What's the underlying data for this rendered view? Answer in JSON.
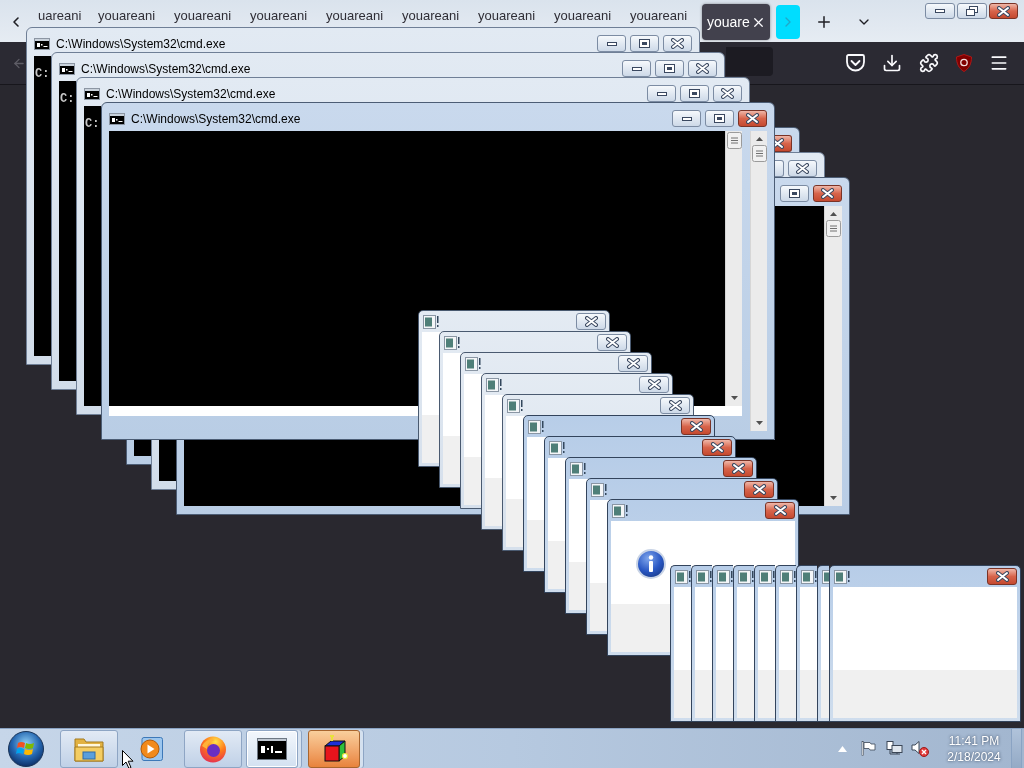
{
  "browser": {
    "tabs": [
      {
        "label": "uareani",
        "selected": false
      },
      {
        "label": "youareani",
        "selected": false
      },
      {
        "label": "youareani",
        "selected": false
      },
      {
        "label": "youareani",
        "selected": false
      },
      {
        "label": "youareani",
        "selected": false
      },
      {
        "label": "youareani",
        "selected": false
      },
      {
        "label": "youareani",
        "selected": false
      },
      {
        "label": "youareani",
        "selected": false
      },
      {
        "label": "youareani",
        "selected": false
      },
      {
        "label": "youare",
        "selected": true
      }
    ]
  },
  "cmd_windows_back": [
    {
      "active": true
    },
    {
      "active": false
    },
    {
      "active": true
    }
  ],
  "cmd_windows": [
    {
      "title": "C:\\Windows\\System32\\cmd.exe",
      "prompt": "C:",
      "active": false
    },
    {
      "title": "C:\\Windows\\System32\\cmd.exe",
      "prompt": "C:",
      "active": false
    },
    {
      "title": "C:\\Windows\\System32\\cmd.exe",
      "prompt": "C:",
      "active": false
    },
    {
      "title": "C:\\Windows\\System32\\cmd.exe",
      "active": true
    }
  ],
  "message_boxes": [
    {
      "active": false
    },
    {
      "active": false
    },
    {
      "active": false
    },
    {
      "active": false
    },
    {
      "active": false
    },
    {
      "active": true
    },
    {
      "active": true
    },
    {
      "active": true
    },
    {
      "active": true
    },
    {
      "active": true,
      "kind": "information"
    }
  ],
  "message_box_row": [
    {
      "active": true
    },
    {
      "active": true
    },
    {
      "active": true
    },
    {
      "active": true
    },
    {
      "active": true
    },
    {
      "active": true
    },
    {
      "active": true
    },
    {
      "active": true
    },
    {
      "active": true
    }
  ],
  "taskbar": {
    "buttons": [
      {
        "kind": "explorer",
        "running": true,
        "selected": false,
        "grouped": false,
        "flashing": false
      },
      {
        "kind": "media_player",
        "running": false,
        "selected": false,
        "grouped": false,
        "flashing": false
      },
      {
        "kind": "firefox",
        "running": true,
        "selected": false,
        "grouped": false,
        "flashing": false
      },
      {
        "kind": "console",
        "running": true,
        "selected": true,
        "grouped": true,
        "flashing": false
      },
      {
        "kind": "cube_app",
        "running": true,
        "selected": false,
        "grouped": true,
        "flashing": true
      }
    ],
    "clock": {
      "time": "11:41 PM",
      "date": "2/18/2024"
    }
  }
}
